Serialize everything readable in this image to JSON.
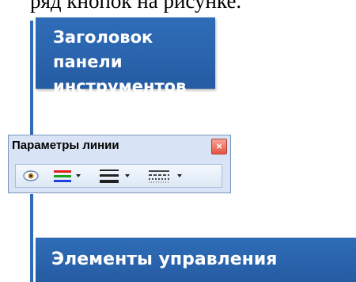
{
  "top_text": "ряд кнопок на рисунке.",
  "callout_title": {
    "line1": "Заголовок панели",
    "line2": "инструментов"
  },
  "toolbar": {
    "title": "Параметры линии",
    "close_symbol": "×",
    "buttons": [
      {
        "icon": "eye-icon"
      },
      {
        "icon": "line-color-icon",
        "colors": [
          "#e02020",
          "#20a020",
          "#2040e0"
        ]
      },
      {
        "icon": "line-weight-icon"
      },
      {
        "icon": "line-style-icon"
      }
    ]
  },
  "callout_controls": "Элементы управления",
  "colors": {
    "callout_bg": "#2f6db8",
    "toolbar_bg": "#d8e4f5",
    "close_bg": "#e2543f"
  }
}
